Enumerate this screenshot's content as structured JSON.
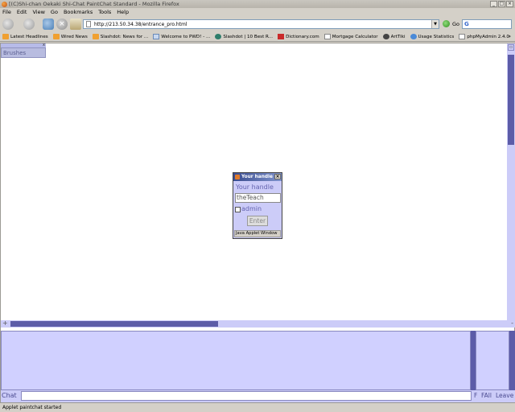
{
  "window": {
    "title": "[(C)Shi-chan Oekaki Shi-Chat PaintChat Standard - Mozilla Firefox",
    "controls": [
      "_",
      "□",
      "×"
    ]
  },
  "menu": [
    "File",
    "Edit",
    "View",
    "Go",
    "Bookmarks",
    "Tools",
    "Help"
  ],
  "nav": {
    "url": "http://213.50.34.38/entrance_pro.html",
    "go_label": "Go",
    "search_icon": "G"
  },
  "bookmarks": [
    {
      "label": "Latest Headlines",
      "icon": "rss"
    },
    {
      "label": "Wired News",
      "icon": "rss"
    },
    {
      "label": "Slashdot: News for ...",
      "icon": "rss"
    },
    {
      "label": "Welcome to PWD! - ...",
      "icon": "site"
    },
    {
      "label": "Slashdot | 10 Best R...",
      "icon": "slashdot"
    },
    {
      "label": "Dictionary.com",
      "icon": "dict"
    },
    {
      "label": "Mortgage Calculator",
      "icon": "page"
    },
    {
      "label": "ArtTiki",
      "icon": "artiki"
    },
    {
      "label": "Usage Statistics",
      "icon": "stats"
    },
    {
      "label": "phpMyAdmin 2.4.0",
      "icon": "page"
    }
  ],
  "bookmarks_more": "»",
  "applet": {
    "brushes_label": "Brushes",
    "brushes_close": "x",
    "vscroll_up": "▫",
    "hscroll_plus": "+",
    "hscroll_minus": "-",
    "chat_label": "Chat",
    "buttons": {
      "f": "F",
      "fall": "FAll",
      "leave": "Leave"
    }
  },
  "dialog": {
    "title": "Your handle",
    "close": "×",
    "handle_label": "Your handle",
    "handle_value": "theTeach",
    "admin_label": "admin",
    "enter_label": "Enter",
    "footer": "Java Applet Window"
  },
  "status": {
    "text": "Applet paintchat started"
  },
  "colors": {
    "applet_bg": "#ccccf8",
    "applet_dark": "#5c5ca8",
    "applet_text": "#6464b0"
  }
}
